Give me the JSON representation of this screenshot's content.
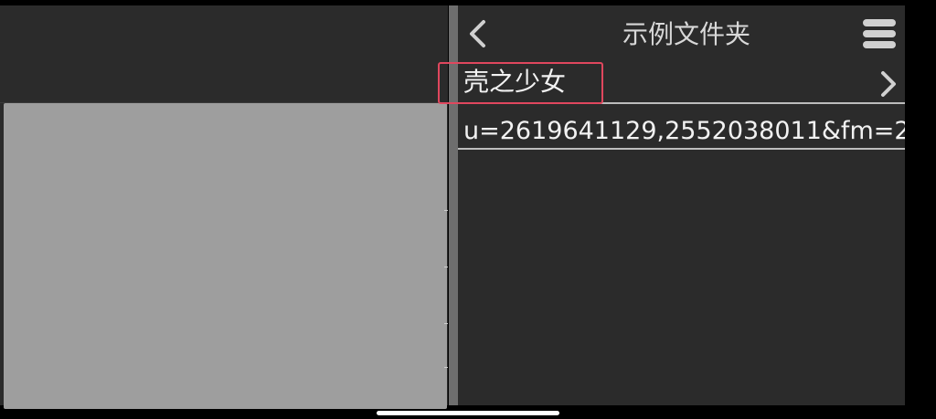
{
  "header": {
    "title": "示例文件夹",
    "back_icon": "chevron-left-icon",
    "menu_icon": "hamburger-menu-icon"
  },
  "list": {
    "items": [
      {
        "label": "壳之少女",
        "type": "folder",
        "icon": "chevron-right-icon"
      },
      {
        "label": "u=2619641129,2552038011&fm=2",
        "type": "file"
      }
    ]
  },
  "colors": {
    "background": "#2b2b2b",
    "text": "#f2f2f2",
    "title_text": "#d8d8d8",
    "preview_gray": "#9e9e9e",
    "divider": "#6e6e6e",
    "highlight": "#e0475e"
  }
}
